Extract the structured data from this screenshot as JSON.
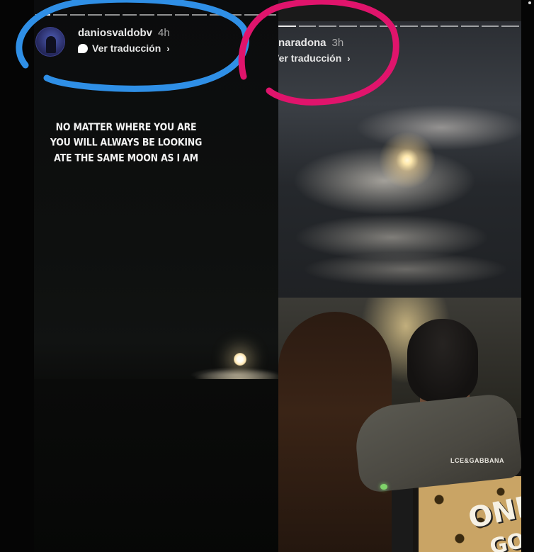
{
  "stories": {
    "left": {
      "username": "daniosvaldobv",
      "time": "4h",
      "translate_label": "Ver traducción",
      "chevron": "›",
      "quote_lines": [
        "NO MATTER WHERE YOU ARE",
        "YOU WILL ALWAYS BE LOOKING",
        "ATE THE SAME MOON AS I AM"
      ]
    },
    "right": {
      "username": "naradona",
      "time": "3h",
      "translate_label": "Ver traducción",
      "chevron": "›",
      "shirt_brand": "LCE&GABBANA",
      "shirt_word_1": "ONL",
      "shirt_word_2": "GOOD"
    }
  },
  "annotations": {
    "left_circle_color": "#2f8fe6",
    "right_circle_color": "#e0146c"
  },
  "icons": {
    "translate": "speech-bubble-icon",
    "chevron": "chevron-right-icon"
  }
}
